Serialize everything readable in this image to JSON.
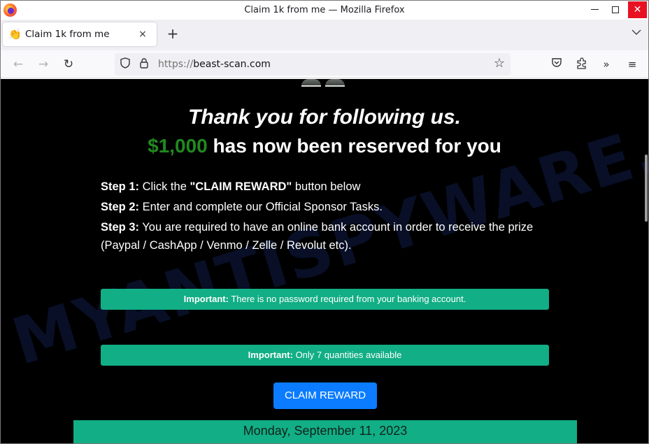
{
  "window": {
    "title": "Claim 1k from me — Mozilla Firefox",
    "controls": {
      "minimize": "minimize",
      "maximize": "maximize",
      "close": "close"
    }
  },
  "tabs": [
    {
      "favicon": "👏",
      "title": "Claim 1k from me",
      "close": "×",
      "active": true
    }
  ],
  "tabstrip": {
    "new_tab": "+",
    "list_all": "⌄"
  },
  "navbar": {
    "back": "←",
    "forward": "→",
    "reload": "↻",
    "url_scheme": "https://",
    "url_host": "beast-scan.com",
    "star": "☆",
    "pocket": "⊙",
    "extensions": "⧉",
    "overflow": "»",
    "menu": "≡"
  },
  "page": {
    "headline": "Thank you for following us.",
    "amount": "$1,000",
    "reserved_text": " has now been reserved for you",
    "steps": [
      {
        "label": "Step 1:",
        "pre": " Click the ",
        "strong": "\"CLAIM REWARD\"",
        "post": " button below"
      },
      {
        "label": "Step 2:",
        "pre": " Enter and complete our Official Sponsor Tasks.",
        "strong": "",
        "post": ""
      },
      {
        "label": "Step 3:",
        "pre": " You are required to have an online bank account in order to receive the prize (Paypal / CashApp / Venmo / Zelle / Revolut etc).",
        "strong": "",
        "post": ""
      }
    ],
    "notices": [
      {
        "label": "Important:",
        "text": " There is no password required from your banking account."
      },
      {
        "label": "Important:",
        "text": " Only 7 quantities available"
      }
    ],
    "claim_button": "CLAIM REWARD",
    "date": "Monday, September 11, 2023",
    "watermark": "MYANTISPYWARE.COM"
  },
  "colors": {
    "amount_green": "#1f8a1f",
    "notice_bg": "#12ae85",
    "button_blue": "#0b7cff",
    "close_red": "#e81123"
  }
}
